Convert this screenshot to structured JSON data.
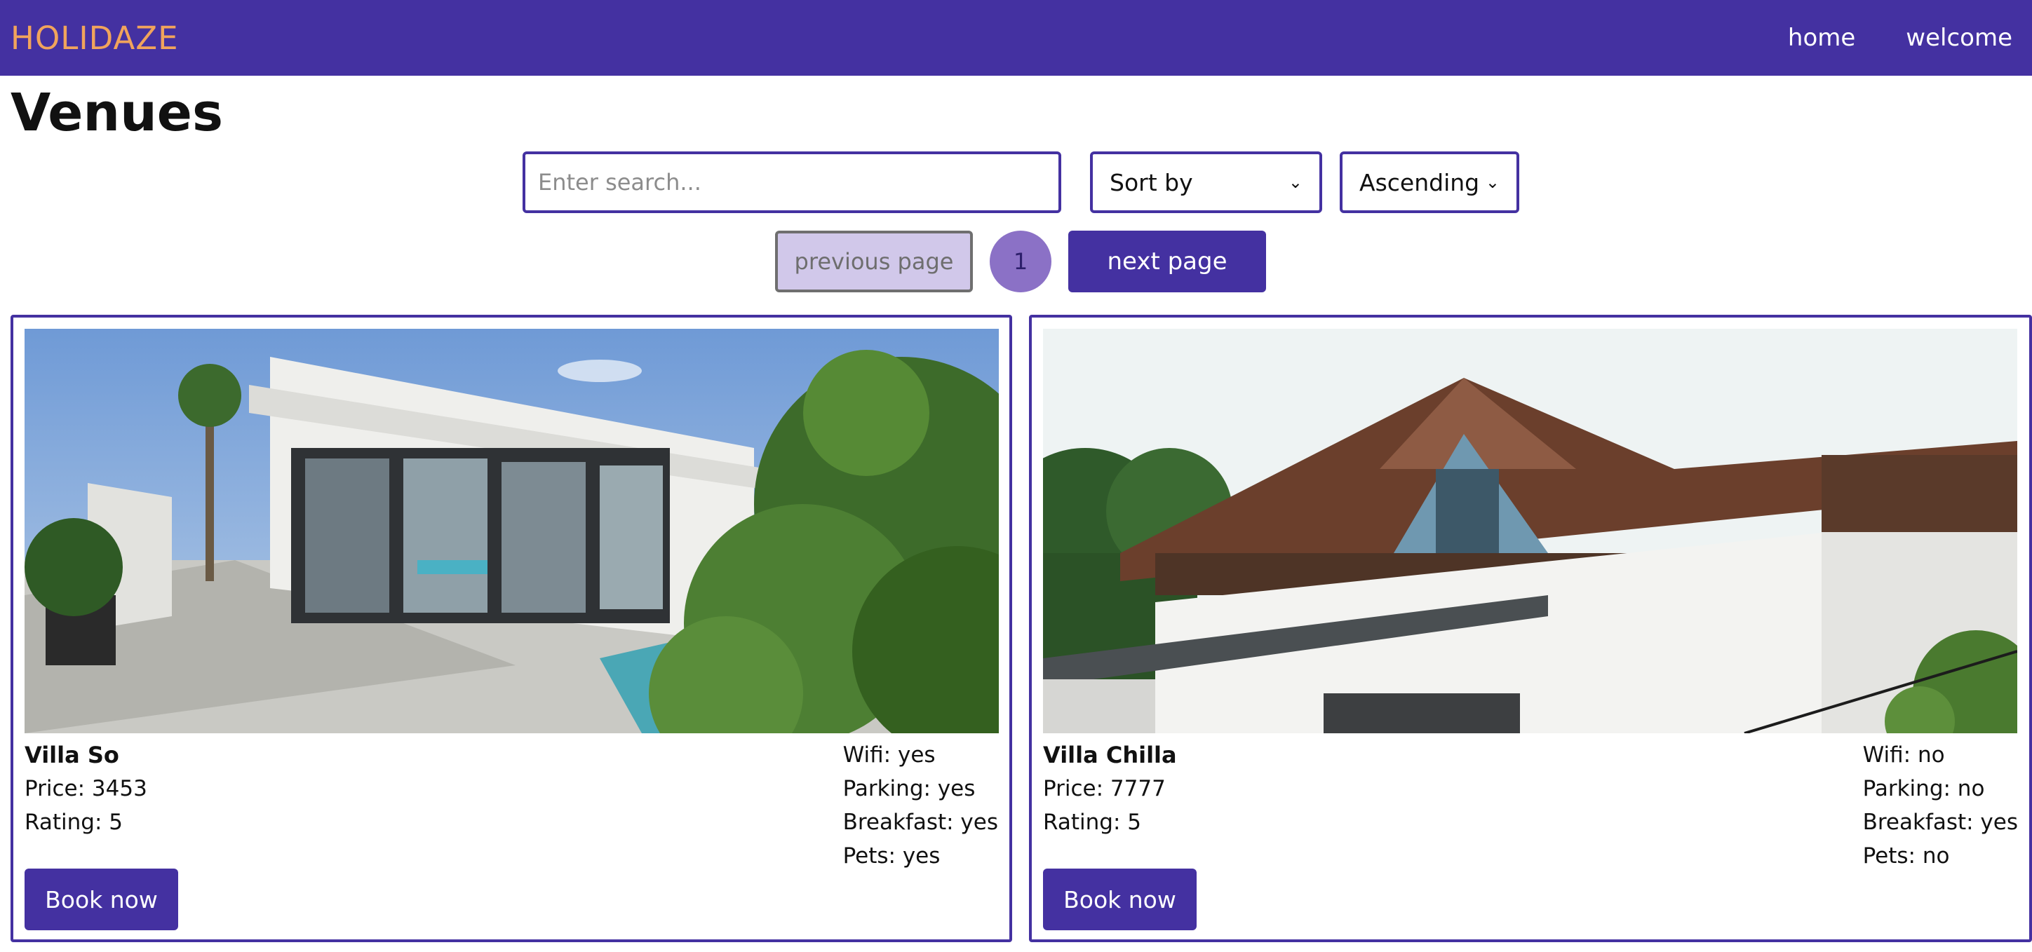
{
  "navbar": {
    "brand": "HOLIDAZE",
    "links": [
      {
        "label": "home"
      },
      {
        "label": "welcome"
      }
    ],
    "colors": {
      "background": "#4431a1",
      "brand": "#f1a45c"
    }
  },
  "page": {
    "title": "Venues"
  },
  "controls": {
    "search_placeholder": "Enter search...",
    "sort_selected": "Sort by",
    "order_selected": "Ascending"
  },
  "pagination": {
    "prev_label": "previous page",
    "current_page": "1",
    "next_label": "next page"
  },
  "venues": [
    {
      "name": "Villa So",
      "price": "Price: 3453",
      "rating": "Rating: 5",
      "wifi": "Wifi: yes",
      "parking": "Parking: yes",
      "breakfast": "Breakfast: yes",
      "pets": "Pets: yes",
      "book_label": "Book now",
      "image": "modern-white-villa-with-pool-photo"
    },
    {
      "name": "Villa Chilla",
      "price": "Price: 7777",
      "rating": "Rating: 5",
      "wifi": "Wifi: no",
      "parking": "Parking: no",
      "breakfast": "Breakfast: yes",
      "pets": "Pets: no",
      "book_label": "Book now",
      "image": "white-house-with-wooden-roof-photo"
    }
  ]
}
